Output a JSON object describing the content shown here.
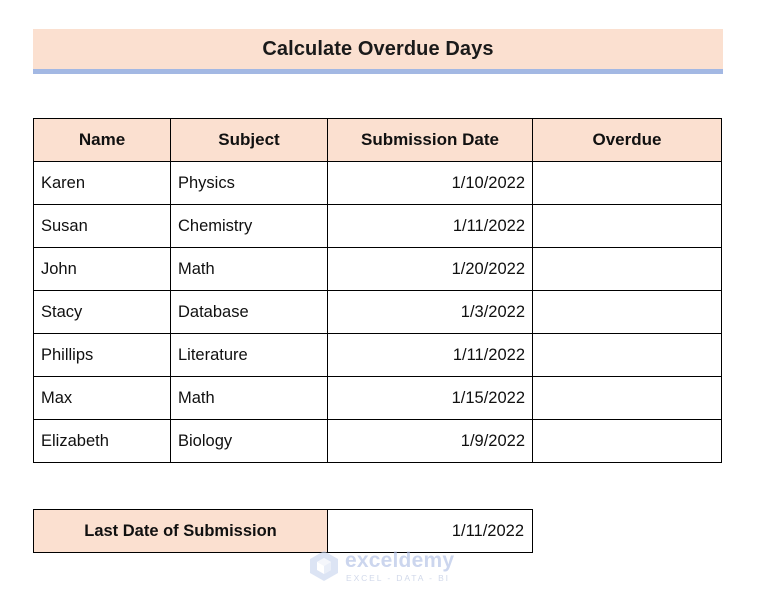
{
  "title": {
    "text": "Calculate Overdue Days",
    "band_color": "#FBE0D0",
    "underline_color": "#A3B8E3"
  },
  "table": {
    "headers": [
      "Name",
      "Subject",
      "Submission Date",
      "Overdue"
    ],
    "header_bg": "#FBE0D0",
    "border_color": "#000000",
    "rows": [
      {
        "name": "Karen",
        "subject": "Physics",
        "submission_date": "1/10/2022",
        "overdue": ""
      },
      {
        "name": "Susan",
        "subject": "Chemistry",
        "submission_date": "1/11/2022",
        "overdue": ""
      },
      {
        "name": "John",
        "subject": "Math",
        "submission_date": "1/20/2022",
        "overdue": ""
      },
      {
        "name": "Stacy",
        "subject": "Database",
        "submission_date": "1/3/2022",
        "overdue": ""
      },
      {
        "name": "Phillips",
        "subject": "Literature",
        "submission_date": "1/11/2022",
        "overdue": ""
      },
      {
        "name": "Max",
        "subject": "Math",
        "submission_date": "1/15/2022",
        "overdue": ""
      },
      {
        "name": "Elizabeth",
        "subject": "Biology",
        "submission_date": "1/9/2022",
        "overdue": ""
      }
    ]
  },
  "footer": {
    "label": "Last Date of Submission",
    "value": "1/11/2022"
  },
  "watermark": {
    "name": "exceldemy",
    "tagline": "EXCEL - DATA - BI",
    "icon": "cube-logo-icon",
    "color": "#aebde4"
  }
}
